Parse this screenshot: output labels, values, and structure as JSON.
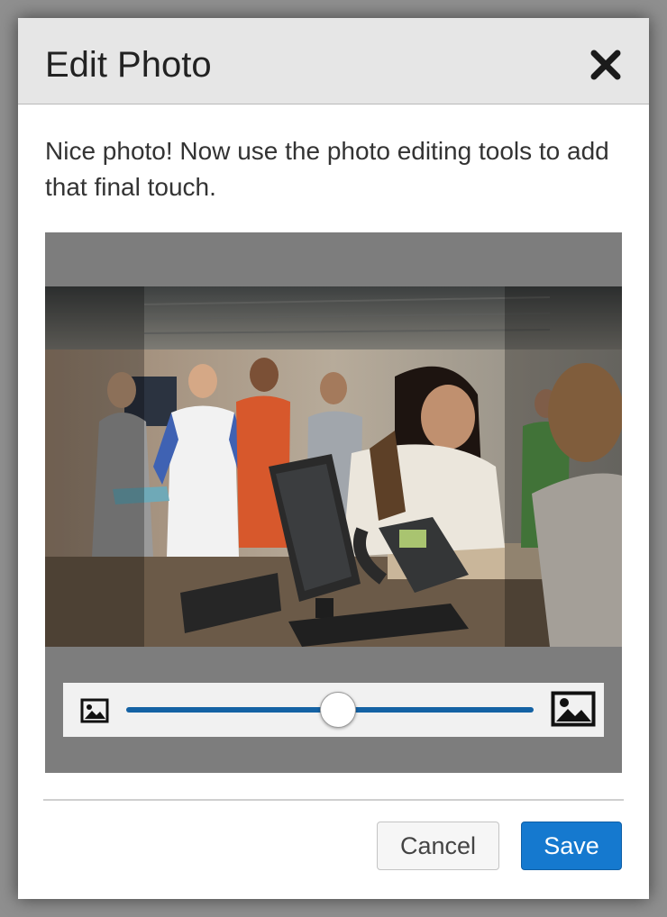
{
  "dialog": {
    "title": "Edit Photo",
    "close_icon": "close-x-icon",
    "intro_text": "Nice photo! Now use the photo editing tools to add that final touch."
  },
  "editor": {
    "photo_alt": "Students at a help desk, woman smiling while writing",
    "zoom": {
      "min_icon": "image-small-icon",
      "max_icon": "image-large-icon",
      "level": 0.52,
      "track_color": "#1462a4"
    }
  },
  "footer": {
    "cancel_label": "Cancel",
    "save_label": "Save",
    "save_color": "#1579cf"
  }
}
